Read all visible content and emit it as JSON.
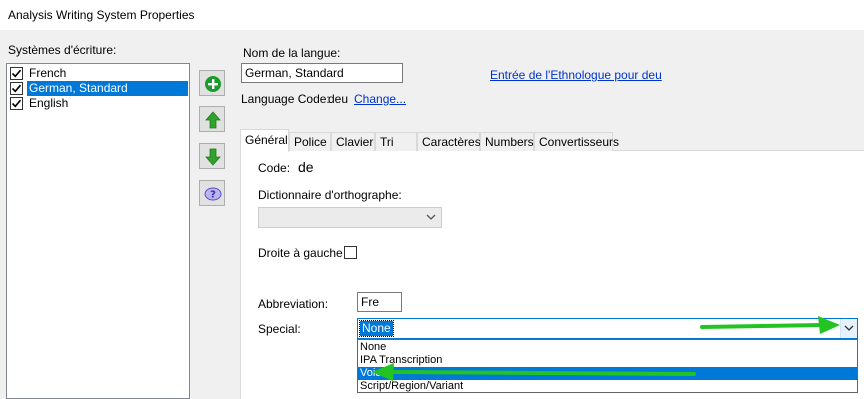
{
  "window": {
    "title": "Analysis Writing System Properties"
  },
  "writing_systems": {
    "label": "Systèmes d'écriture:",
    "items": [
      {
        "label": "French",
        "checked": true,
        "selected": false
      },
      {
        "label": "German, Standard",
        "checked": true,
        "selected": true
      },
      {
        "label": "English",
        "checked": true,
        "selected": false
      }
    ]
  },
  "side_buttons": [
    {
      "icon": "plus-circle-icon",
      "color": "#1a9b2c"
    },
    {
      "icon": "arrow-up-icon",
      "color": "#2fa12c"
    },
    {
      "icon": "arrow-down-icon",
      "color": "#2fa12c"
    },
    {
      "icon": "help-icon",
      "color": "#5a4fc9"
    }
  ],
  "language": {
    "name_label": "Nom de la langue:",
    "name_value": "German, Standard",
    "ethnologue_link": "Entrée de l'Ethnologue pour deu",
    "code_label": "Language Code:",
    "code_value": "deu",
    "change_link": "Change..."
  },
  "tabs": [
    {
      "label": "Général",
      "active": true
    },
    {
      "label": "Police",
      "active": false
    },
    {
      "label": "Clavier",
      "active": false
    },
    {
      "label": "Tri",
      "active": false
    },
    {
      "label": "Caractères",
      "active": false
    },
    {
      "label": "Numbers",
      "active": false
    },
    {
      "label": "Convertisseurs",
      "active": false
    }
  ],
  "general": {
    "code_label": "Code:",
    "code_value": "de",
    "dictionary_label": "Dictionnaire d'orthographe:",
    "dictionary_value": "",
    "rtl_label": "Droite à gauche",
    "rtl_checked": false,
    "abbreviation_label": "Abbreviation:",
    "abbreviation_value": "Fre",
    "special_label": "Special:",
    "special_value": "None",
    "special_options": [
      "None",
      "IPA Transcription",
      "Voice",
      "Script/Region/Variant"
    ],
    "special_highlighted": "Voice"
  },
  "colors": {
    "selection": "#0078d7",
    "link": "#0033cc",
    "annotation_arrow": "#22c322"
  }
}
